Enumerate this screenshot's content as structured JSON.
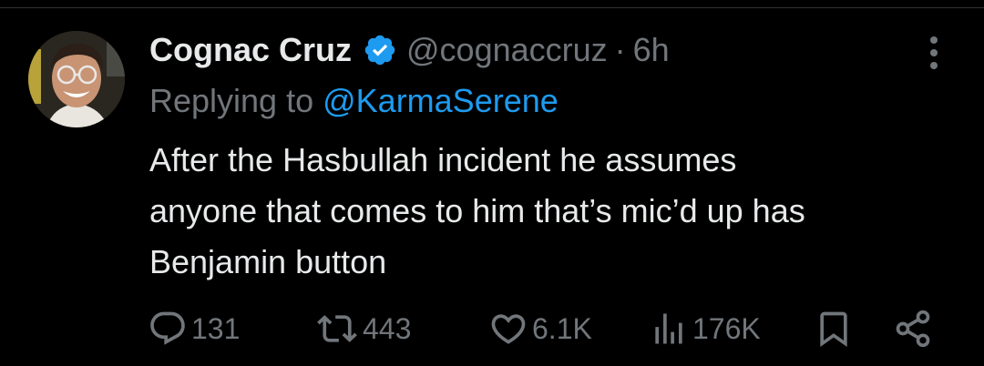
{
  "tweet": {
    "author_name": "Cognac Cruz",
    "verified": true,
    "handle": "@cognaccruz",
    "separator": "·",
    "time": "6h",
    "replying_label": "Replying to",
    "replying_to": "@KarmaSerene",
    "text_lines": [
      "After the Hasbullah incident he assumes",
      "anyone that comes to him that’s mic’d up has",
      "Benjamin button"
    ]
  },
  "actions": {
    "replies": "131",
    "reposts": "443",
    "likes": "6.1K",
    "views": "176K"
  },
  "icons": {
    "avatar": "avatar-photo",
    "verified": "verified-badge-icon",
    "more": "more-vertical-icon",
    "reply": "reply-icon",
    "repost": "repost-icon",
    "like": "heart-icon",
    "views": "analytics-icon",
    "bookmark": "bookmark-icon",
    "share": "share-icon"
  },
  "colors": {
    "background": "#000000",
    "text": "#e7e9ea",
    "muted": "#71767b",
    "accent": "#1d9bf0"
  }
}
